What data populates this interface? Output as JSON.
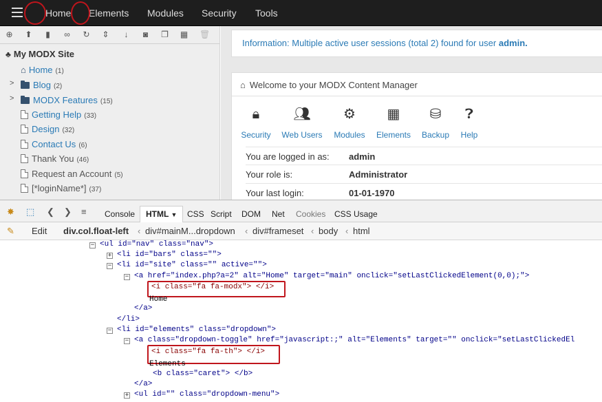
{
  "topnav": {
    "items": [
      "Home",
      "Elements",
      "Modules",
      "Security",
      "Tools"
    ]
  },
  "tree": {
    "root": "My MODX Site",
    "nodes": [
      {
        "label": "Home",
        "count": "(1)"
      },
      {
        "label": "Blog",
        "count": "(2)"
      },
      {
        "label": "MODX Features",
        "count": "(15)"
      },
      {
        "label": "Getting Help",
        "count": "(33)"
      },
      {
        "label": "Design",
        "count": "(32)"
      },
      {
        "label": "Contact Us",
        "count": "(6)"
      },
      {
        "label": "Thank You",
        "count": "(46)"
      },
      {
        "label": "Request an Account",
        "count": "(5)"
      },
      {
        "label": "[*loginName*]",
        "count": "(37)"
      }
    ]
  },
  "info": {
    "text": "Information: Multiple active user sessions (total 2) found for user",
    "user": "admin."
  },
  "welcome": {
    "title": "Welcome to your MODX Content Manager",
    "icons": [
      "Security",
      "Web Users",
      "Modules",
      "Elements",
      "Backup",
      "Help"
    ],
    "rows": [
      {
        "key": "You are logged in as:",
        "value": "admin"
      },
      {
        "key": "Your role is:",
        "value": "Administrator"
      },
      {
        "key": "Your last login:",
        "value": "01-01-1970"
      }
    ]
  },
  "firebug": {
    "tabs": [
      "Console",
      "HTML",
      "CSS",
      "Script",
      "DOM",
      "Net",
      "Cookies",
      "CSS Usage"
    ],
    "active_tab": "HTML",
    "crumbs": [
      "Edit",
      "div.col.float-left",
      "div#mainM...dropdown",
      "div#frameset",
      "body",
      "html"
    ],
    "code": [
      "<ul id=\"nav\" class=\"nav\">",
      "<li id=\"bars\" class=\"\">",
      "<li id=\"site\" class=\"\" active=\"\">",
      "<a href=\"index.php?a=2\" alt=\"Home\" target=\"main\" onclick=\"setLastClickedElement(0,0);\">",
      "<i class=\"fa fa-modx\"> </i>",
      "Home",
      "</a>",
      "</li>",
      "<li id=\"elements\" class=\"dropdown\">",
      "<a class=\"dropdown-toggle\" href=\"javascript:;\" alt=\"Elements\" target=\"\" onclick=\"setLastClickedEl",
      "<i class=\"fa fa-th\"> </i>",
      "Elements",
      "<b class=\"caret\"> </b>",
      "</a>",
      "<ul id=\"\" class=\"dropdown-menu\">"
    ]
  },
  "icons": [
    "hamburger-icon",
    "sitemap-icon",
    "home-icon",
    "folder-icon",
    "document-icon",
    "lock-icon",
    "users-icon",
    "cogs-icon",
    "grid-icon",
    "database-icon",
    "question-icon"
  ],
  "colors": {
    "accent": "#2a7ab5",
    "topbar": "#1e1e1e",
    "annotation": "#c0151c"
  }
}
